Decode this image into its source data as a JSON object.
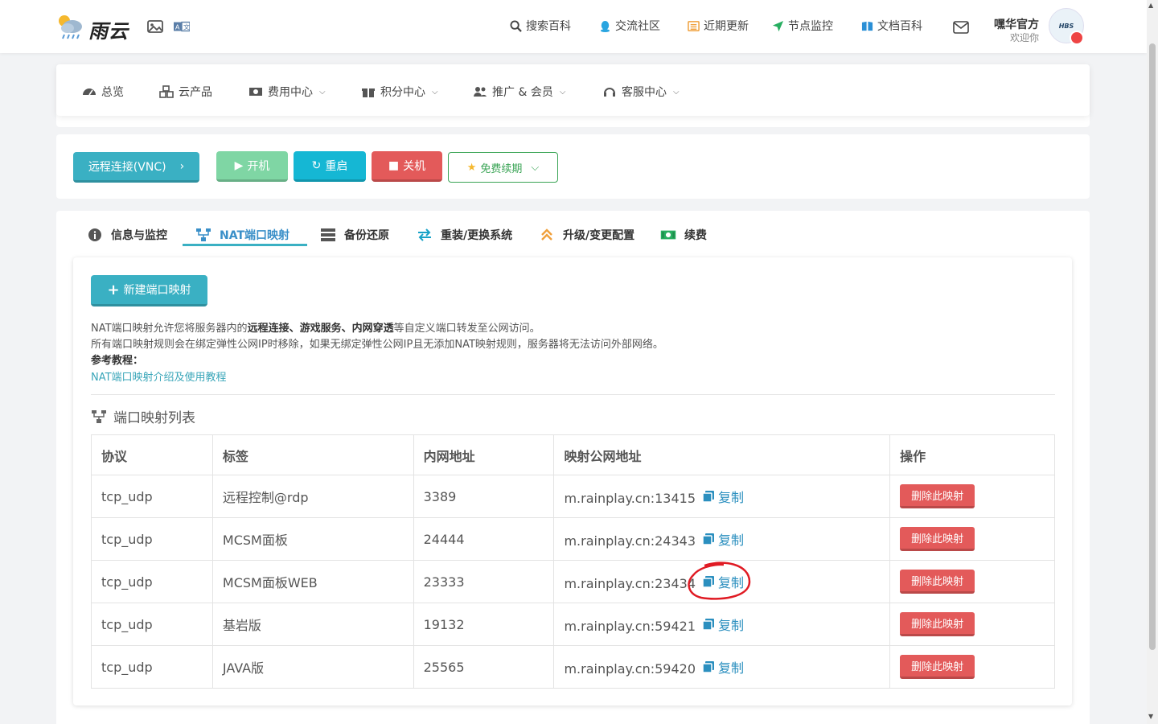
{
  "header": {
    "logo_text": "雨云",
    "nav": [
      {
        "label": "搜索百科",
        "icon": "search-icon"
      },
      {
        "label": "交流社区",
        "icon": "qq-icon"
      },
      {
        "label": "近期更新",
        "icon": "list-icon"
      },
      {
        "label": "节点监控",
        "icon": "send-icon"
      },
      {
        "label": "文档百科",
        "icon": "book-icon"
      }
    ],
    "user_name": "嘿华官方",
    "user_welcome": "欢迎你",
    "avatar_text": "HBS"
  },
  "module_nav": [
    {
      "label": "总览",
      "icon": "dashboard-icon",
      "dropdown": false
    },
    {
      "label": "云产品",
      "icon": "cubes-icon",
      "dropdown": false
    },
    {
      "label": "费用中心",
      "icon": "money-icon",
      "dropdown": true
    },
    {
      "label": "积分中心",
      "icon": "gift-icon",
      "dropdown": true
    },
    {
      "label": "推广 & 会员",
      "icon": "users-icon",
      "dropdown": true
    },
    {
      "label": "客服中心",
      "icon": "headset-icon",
      "dropdown": true
    }
  ],
  "actions": {
    "vnc": "远程连接(VNC)",
    "start": "开机",
    "restart": "重启",
    "shutdown": "关机",
    "renew": "免费续期"
  },
  "tabs": [
    {
      "label": "信息与监控",
      "icon": "info-icon"
    },
    {
      "label": "NAT端口映射",
      "icon": "sitemap-icon",
      "active": true
    },
    {
      "label": "备份还原",
      "icon": "server-icon"
    },
    {
      "label": "重装/更换系统",
      "icon": "exchange-icon"
    },
    {
      "label": "升级/变更配置",
      "icon": "upgrade-icon"
    },
    {
      "label": "续费",
      "icon": "cash-icon"
    }
  ],
  "nat": {
    "new_button": "新建端口映射",
    "desc1_pre": "NAT端口映射允许您将服务器内的",
    "desc1_b1": "远程连接",
    "desc1_sep1": "、",
    "desc1_b2": "游戏服务",
    "desc1_sep2": "、",
    "desc1_b3": "内网穿透",
    "desc1_post": "等自定义端口转发至公网访问。",
    "desc2": "所有端口映射规则会在绑定弹性公网IP时移除，如果无绑定弹性公网IP且无添加NAT映射规则，服务器将无法访问外部网络。",
    "ref_label": "参考教程：",
    "ref_link": "NAT端口映射介绍及使用教程",
    "list_title": "端口映射列表",
    "columns": [
      "协议",
      "标签",
      "内网地址",
      "映射公网地址",
      "操作"
    ],
    "copy_label": "复制",
    "delete_label": "删除此映射",
    "rows": [
      {
        "protocol": "tcp_udp",
        "label": "远程控制@rdp",
        "internal": "3389",
        "public": "m.rainplay.cn:13415"
      },
      {
        "protocol": "tcp_udp",
        "label": "MCSM面板",
        "internal": "24444",
        "public": "m.rainplay.cn:24343"
      },
      {
        "protocol": "tcp_udp",
        "label": "MCSM面板WEB",
        "internal": "23333",
        "public": "m.rainplay.cn:23434"
      },
      {
        "protocol": "tcp_udp",
        "label": "基岩版",
        "internal": "19132",
        "public": "m.rainplay.cn:59421"
      },
      {
        "protocol": "tcp_udp",
        "label": "JAVA版",
        "internal": "25565",
        "public": "m.rainplay.cn:59420"
      }
    ]
  },
  "colors": {
    "accent": "#3ab0c3",
    "danger": "#e35a5a",
    "success": "#7fd6a4",
    "link": "#2b8fbf",
    "annotation": "#e01b24"
  }
}
